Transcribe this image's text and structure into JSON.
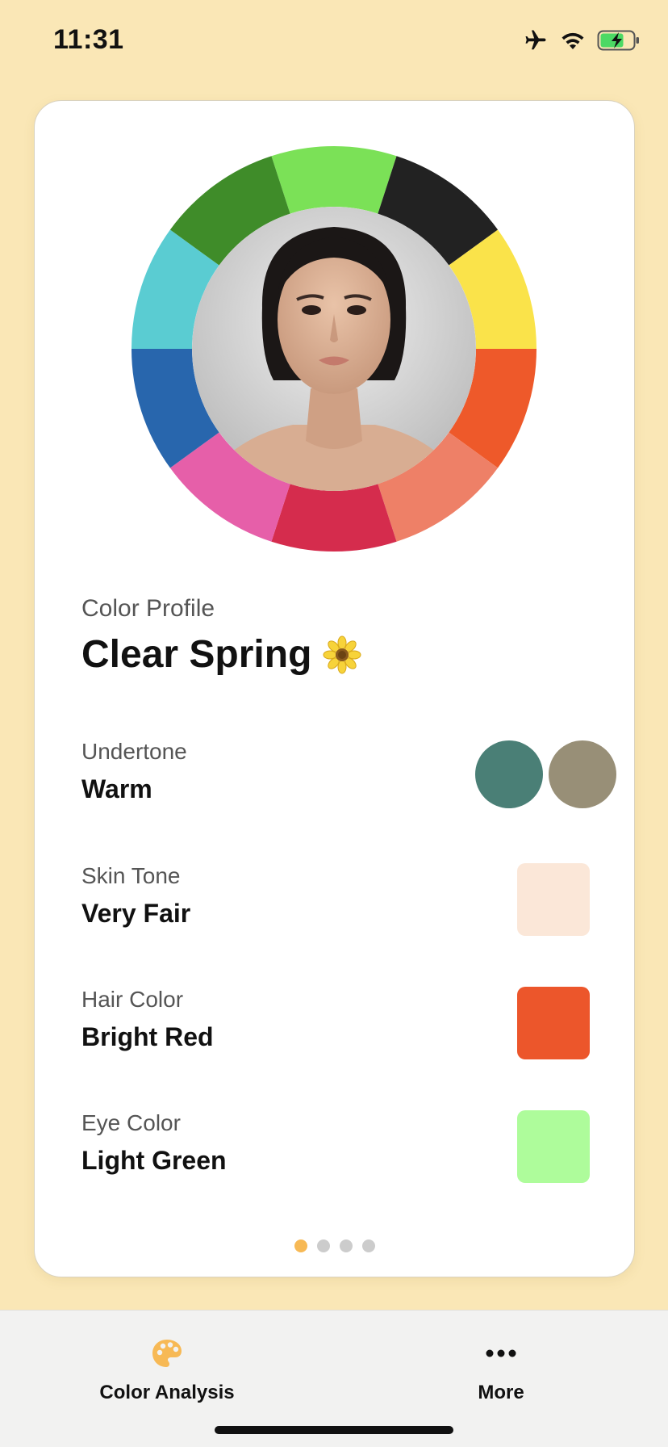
{
  "status_bar": {
    "time": "11:31"
  },
  "wheel": {
    "segments": [
      "#7be157",
      "#222222",
      "#fae34a",
      "#ee592a",
      "#ee8067",
      "#d52c4d",
      "#e65fa9",
      "#2866ad",
      "#5accd2",
      "#3f8c29"
    ]
  },
  "profile": {
    "caption": "Color Profile",
    "title": "Clear Spring",
    "emoji_icon": "sunflower-icon"
  },
  "attributes": [
    {
      "label": "Undertone",
      "value": "Warm",
      "swatches": [
        "#4a7f76",
        "#988f77"
      ]
    },
    {
      "label": "Skin Tone",
      "value": "Very Fair",
      "swatch": "#fbe7d8"
    },
    {
      "label": "Hair Color",
      "value": "Bright Red",
      "swatch": "#ec562b"
    },
    {
      "label": "Eye Color",
      "value": "Light Green",
      "swatch": "#aefc9b"
    }
  ],
  "pagination": {
    "count": 4,
    "active": 0,
    "active_color": "#f7b955"
  },
  "tab_bar": {
    "tabs": [
      {
        "label": "Color Analysis",
        "icon": "palette-icon",
        "color": "#f7b955"
      },
      {
        "label": "More",
        "icon": "ellipsis-icon"
      }
    ]
  },
  "colors": {
    "background": "#fae7b6",
    "accent": "#f7b955"
  }
}
